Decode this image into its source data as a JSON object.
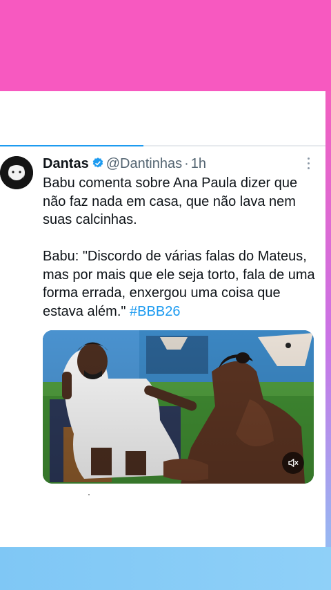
{
  "tweet": {
    "author_name": "Dantas",
    "handle": "@Dantinhas",
    "separator": "·",
    "time": "1h",
    "text_main": "Babu comenta sobre Ana Paula dizer que não faz nada em casa, que não lava nem suas calcinhas.\n\nBabu: \"Discordo de várias falas do Mateus, mas por mais que ele seja torto, fala de uma forma errada, enxergou uma coisa que estava além.\" ",
    "hashtag": "#BBB26",
    "verified": true
  },
  "media": {
    "type": "video",
    "muted": true
  },
  "story_progress": 0.44,
  "icons": {
    "verified": "verified-badge-icon",
    "more": "more-vertical-icon",
    "mute": "volume-muted-icon"
  },
  "colors": {
    "background_top": "#f759c0",
    "background_bottom": "#8fd0f8",
    "accent": "#1d9bf0",
    "text": "#0f1419",
    "muted_text": "#536471"
  }
}
